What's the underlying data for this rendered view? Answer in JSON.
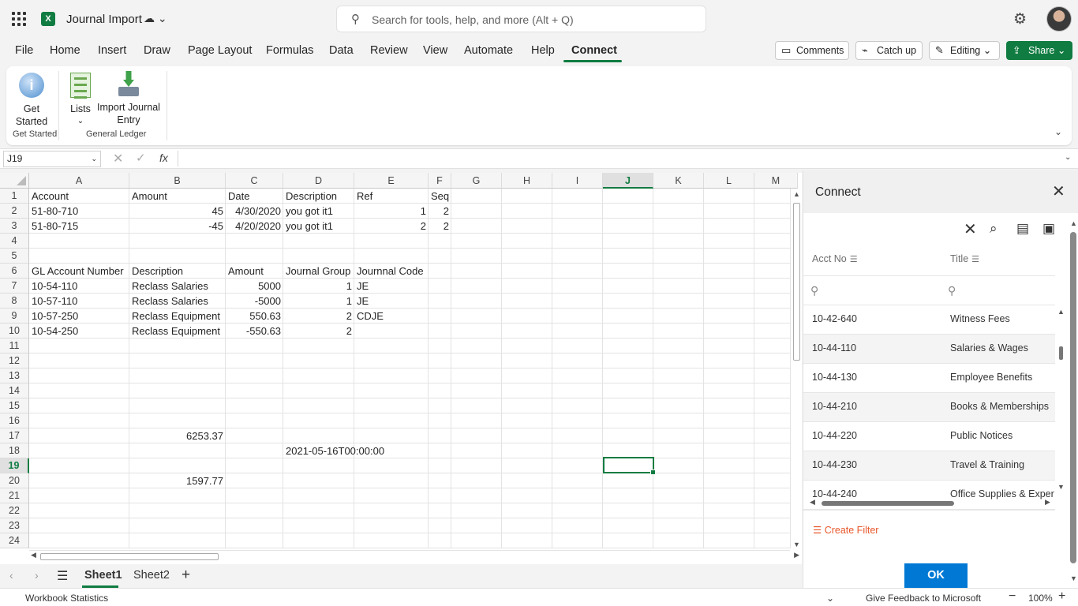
{
  "titlebar": {
    "app_icon": "X",
    "doc_title": "Journal Import",
    "status_icon": "saved-cloud-icon",
    "search_placeholder": "Search for tools, help, and more (Alt + Q)"
  },
  "menu": {
    "tabs": [
      "File",
      "Home",
      "Insert",
      "Draw",
      "Page Layout",
      "Formulas",
      "Data",
      "Review",
      "View",
      "Automate",
      "Help",
      "Connect"
    ],
    "active_tab": "Connect",
    "comments": "Comments",
    "catch_up": "Catch up",
    "editing": "Editing",
    "share": "Share"
  },
  "ribbon": {
    "get_started_line1": "Get",
    "get_started_line2": "Started",
    "lists": "Lists",
    "import_line1": "Import Journal",
    "import_line2": "Entry",
    "group_get_started": "Get Started",
    "group_general_ledger": "General Ledger"
  },
  "formula_bar": {
    "name_box": "J19",
    "fx": "fx",
    "formula": ""
  },
  "grid": {
    "columns": [
      "A",
      "B",
      "C",
      "D",
      "E",
      "F",
      "G",
      "H",
      "I",
      "J",
      "K",
      "L",
      "M"
    ],
    "selected_column": "J",
    "rows": [
      "1",
      "2",
      "3",
      "4",
      "5",
      "6",
      "7",
      "8",
      "9",
      "10",
      "11",
      "12",
      "13",
      "14",
      "15",
      "16",
      "17",
      "18",
      "19",
      "20",
      "21",
      "22",
      "23",
      "24"
    ],
    "selected_row": "19",
    "cells": {
      "A1": "Account",
      "B1": "Amount",
      "C1": "Date",
      "D1": "Description",
      "E1": "Ref",
      "F1": "Seq",
      "A2": "51-80-710",
      "B2": "45",
      "C2": "4/30/2020",
      "D2": "you got it1",
      "E2": "1",
      "F2": "2",
      "A3": "51-80-715",
      "B3": "-45",
      "C3": "4/20/2020",
      "D3": "you got it1",
      "E3": "2",
      "F3": "2",
      "A6": "GL Account Number",
      "B6": "Description",
      "C6": "Amount",
      "D6": "Journal Group",
      "E6": "Journnal Code",
      "A7": "10-54-110",
      "B7": "Reclass Salaries",
      "C7": "5000",
      "D7": "1",
      "E7": "JE",
      "A8": "10-57-110",
      "B8": "Reclass Salaries",
      "C8": "-5000",
      "D8": "1",
      "E8": "JE",
      "A9": "10-57-250",
      "B9": "Reclass Equipment",
      "C9": "550.63",
      "D9": "2",
      "E9": "CDJE",
      "A10": "10-54-250",
      "B10": "Reclass Equipment",
      "C10": "-550.63",
      "D10": "2",
      "B17": "6253.37",
      "D18": "2021-05-16T00:00:00",
      "B20": "1597.77"
    }
  },
  "sheet_tabs": [
    "Sheet1",
    "Sheet2"
  ],
  "active_sheet": "Sheet1",
  "status_bar": {
    "left": "Workbook Statistics",
    "feedback": "Give Feedback to Microsoft",
    "zoom": "100%"
  },
  "panel": {
    "title": "Connect",
    "col_acct": "Acct No",
    "col_title": "Title",
    "rows": [
      {
        "acct": "10-42-640",
        "title": "Witness Fees"
      },
      {
        "acct": "10-44-110",
        "title": "Salaries & Wages"
      },
      {
        "acct": "10-44-130",
        "title": "Employee Benefits"
      },
      {
        "acct": "10-44-210",
        "title": "Books & Memberships"
      },
      {
        "acct": "10-44-220",
        "title": "Public Notices"
      },
      {
        "acct": "10-44-230",
        "title": "Travel & Training"
      },
      {
        "acct": "10-44-240",
        "title": "Office Supplies & Exper"
      }
    ],
    "create_filter": "Create Filter",
    "ok": "OK"
  },
  "colors": {
    "excel_green": "#107c41",
    "ok_blue": "#0078d4",
    "filter_orange": "#e8582c"
  }
}
